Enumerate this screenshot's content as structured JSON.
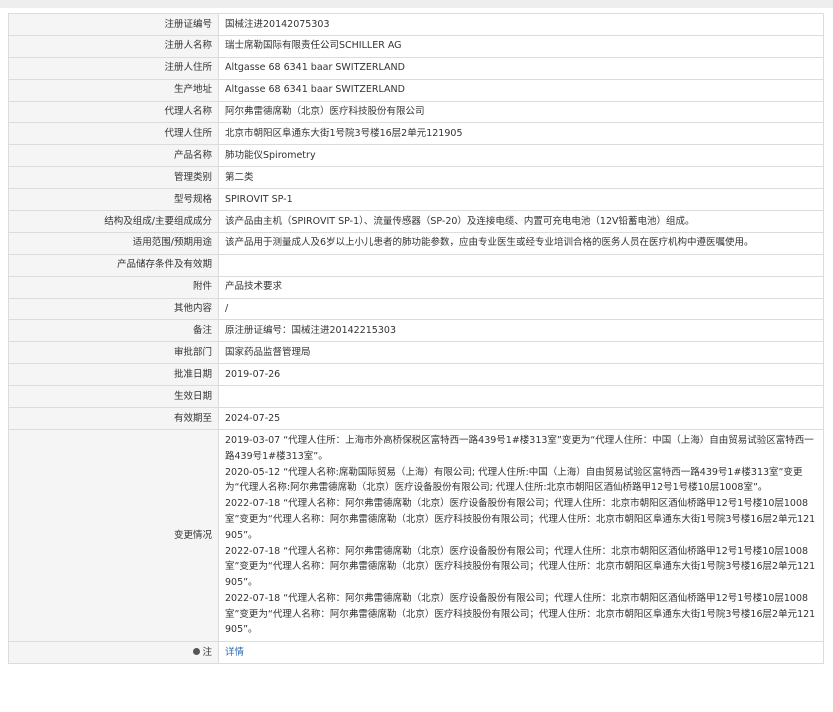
{
  "rows": [
    {
      "label": "注册证编号",
      "value": "国械注进20142075303"
    },
    {
      "label": "注册人名称",
      "value": "瑞士席勒国际有限责任公司SCHILLER AG"
    },
    {
      "label": "注册人住所",
      "value": "Altgasse 68 6341 baar SWITZERLAND"
    },
    {
      "label": "生产地址",
      "value": "Altgasse 68 6341 baar SWITZERLAND"
    },
    {
      "label": "代理人名称",
      "value": "阿尔弗雷德席勒（北京）医疗科技股份有限公司"
    },
    {
      "label": "代理人住所",
      "value": "北京市朝阳区阜通东大街1号院3号楼16层2单元121905"
    },
    {
      "label": "产品名称",
      "value": "肺功能仪Spirometry"
    },
    {
      "label": "管理类别",
      "value": "第二类"
    },
    {
      "label": "型号规格",
      "value": "SPIROVIT SP-1"
    },
    {
      "label": "结构及组成/主要组成成分",
      "value": "该产品由主机（SPIROVIT SP-1）、流量传感器（SP-20）及连接电缆、内置可充电电池（12V铅蓄电池）组成。"
    },
    {
      "label": "适用范围/预期用途",
      "value": "该产品用于测量成人及6岁以上小儿患者的肺功能参数，应由专业医生或经专业培训合格的医务人员在医疗机构中遵医嘱使用。"
    },
    {
      "label": "产品储存条件及有效期",
      "value": ""
    },
    {
      "label": "附件",
      "value": "产品技术要求"
    },
    {
      "label": "其他内容",
      "value": "/"
    },
    {
      "label": "备注",
      "value": "原注册证编号：国械注进20142215303"
    },
    {
      "label": "审批部门",
      "value": "国家药品监督管理局"
    },
    {
      "label": "批准日期",
      "value": "2019-07-26"
    },
    {
      "label": "生效日期",
      "value": ""
    },
    {
      "label": "有效期至",
      "value": "2024-07-25"
    }
  ],
  "changes": {
    "label": "变更情况",
    "entries": [
      "2019-03-07 “代理人住所：上海市外高桥保税区富特西一路439号1#楼313室”变更为“代理人住所：中国（上海）自由贸易试验区富特西一路439号1#楼313室”。",
      "2020-05-12 “代理人名称:席勒国际贸易（上海）有限公司; 代理人住所:中国（上海）自由贸易试验区富特西一路439号1#楼313室”变更为“代理人名称:阿尔弗雷德席勒（北京）医疗设备股份有限公司; 代理人住所:北京市朝阳区酒仙桥路甲12号1号楼10层1008室”。",
      "2022-07-18 “代理人名称：阿尔弗雷德席勒（北京）医疗设备股份有限公司；代理人住所：北京市朝阳区酒仙桥路甲12号1号楼10层1008室”变更为“代理人名称：阿尔弗雷德席勒（北京）医疗科技股份有限公司；代理人住所：北京市朝阳区阜通东大街1号院3号楼16层2单元121905”。",
      "2022-07-18 “代理人名称：阿尔弗雷德席勒（北京）医疗设备股份有限公司；代理人住所：北京市朝阳区酒仙桥路甲12号1号楼10层1008室”变更为“代理人名称：阿尔弗雷德席勒（北京）医疗科技股份有限公司；代理人住所：北京市朝阳区阜通东大街1号院3号楼16层2单元121905”。",
      "2022-07-18 “代理人名称：阿尔弗雷德席勒（北京）医疗设备股份有限公司；代理人住所：北京市朝阳区酒仙桥路甲12号1号楼10层1008室”变更为“代理人名称：阿尔弗雷德席勒（北京）医疗科技股份有限公司；代理人住所：北京市朝阳区阜通东大街1号院3号楼16层2单元121905”。"
    ]
  },
  "note": {
    "label": "注",
    "icon": "bulb-icon",
    "link_text": "详情"
  }
}
